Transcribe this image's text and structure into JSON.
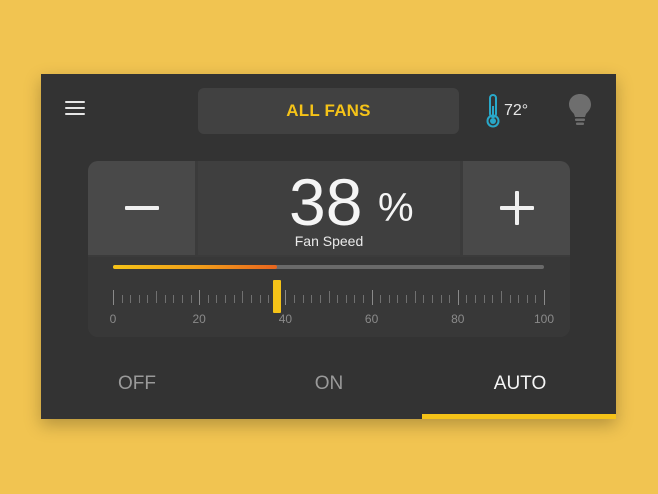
{
  "header": {
    "selector_label": "ALL FANS",
    "temperature": "72°"
  },
  "speed": {
    "value": "38",
    "unit": "%",
    "label": "Fan Speed",
    "level_fraction": 0.38,
    "scale_labels": [
      "0",
      "20",
      "40",
      "60",
      "80",
      "100"
    ]
  },
  "modes": {
    "items": [
      "OFF",
      "ON",
      "AUTO"
    ],
    "selected": "AUTO"
  },
  "colors": {
    "background": "#F1C451",
    "panel": "#333333",
    "accent": "#F5C318",
    "accent_end": "#E8651E",
    "thermometer": "#29A8C9"
  },
  "icons": {
    "menu": "hamburger-menu-icon",
    "thermometer": "thermometer-icon",
    "bulb": "lightbulb-icon",
    "minus": "minus-icon",
    "plus": "plus-icon"
  }
}
